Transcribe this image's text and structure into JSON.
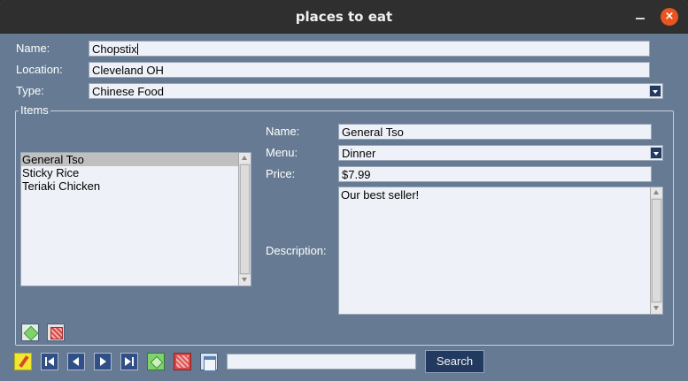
{
  "window": {
    "title": "places to eat",
    "close_glyph": "×"
  },
  "place": {
    "name_label": "Name:",
    "name_value": "Chopstix",
    "location_label": "Location:",
    "location_value": "Cleveland OH",
    "type_label": "Type:",
    "type_value": "Chinese Food"
  },
  "items": {
    "group_title": "Items",
    "list": [
      "General Tso",
      "Sticky Rice",
      "Teriaki Chicken"
    ],
    "selected_index": 0,
    "detail": {
      "name_label": "Name:",
      "name_value": "General Tso",
      "menu_label": "Menu:",
      "menu_value": "Dinner",
      "price_label": "Price:",
      "price_value": "$7.99",
      "description_label": "Description:",
      "description_value": "Our best seller!"
    }
  },
  "toolbar": {
    "search_value": "",
    "search_button_label": "Search"
  },
  "colors": {
    "background": "#667b93",
    "titlebar": "#2f2f2f",
    "close_button": "#e95420",
    "button_dark": "#233a60",
    "field": "#eef2f8"
  },
  "icons": {
    "item_add": "add-icon",
    "item_delete": "delete-icon",
    "edit": "pencil-icon",
    "first": "first-record-icon",
    "previous": "previous-record-icon",
    "next": "next-record-icon",
    "last": "last-record-icon",
    "add": "add-record-icon",
    "delete": "delete-record-icon",
    "save": "save-icon"
  }
}
